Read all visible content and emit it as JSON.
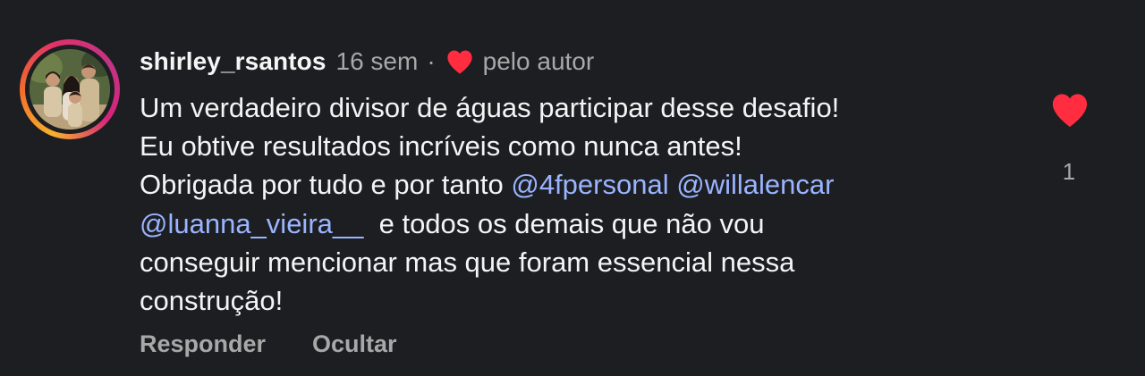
{
  "comment": {
    "username": "shirley_rsantos",
    "time_ago": "16 sem",
    "separator": "·",
    "author_liked_label": "pelo autor",
    "body_lines": [
      [
        {
          "text": "Um verdadeiro divisor de águas participar desse desafio!",
          "type": "text"
        }
      ],
      [
        {
          "text": "Eu obtive resultados incríveis como nunca antes!",
          "type": "text"
        }
      ],
      [
        {
          "text": "Obrigada por tudo e por tanto ",
          "type": "text"
        },
        {
          "text": "@4fpersonal",
          "type": "mention"
        },
        {
          "text": " ",
          "type": "text"
        },
        {
          "text": "@willalencar",
          "type": "mention"
        }
      ],
      [
        {
          "text": "@luanna_vieira__",
          "type": "mention"
        },
        {
          "text": "  e todos os demais que não vou",
          "type": "text"
        }
      ],
      [
        {
          "text": "conseguir mencionar mas que foram essencial nessa",
          "type": "text"
        }
      ],
      [
        {
          "text": "construção!",
          "type": "text"
        }
      ]
    ],
    "like_count": "1",
    "liked": true
  },
  "actions": {
    "reply_label": "Responder",
    "hide_label": "Ocultar"
  },
  "icons": {
    "author_heart": "heart-icon",
    "like_heart": "like-heart-icon"
  },
  "colors": {
    "background": "#1c1e22",
    "text": "#f4f4f4",
    "muted": "#a8a8a8",
    "mention": "#9ab4ff",
    "heart": "#ff2d3f"
  }
}
